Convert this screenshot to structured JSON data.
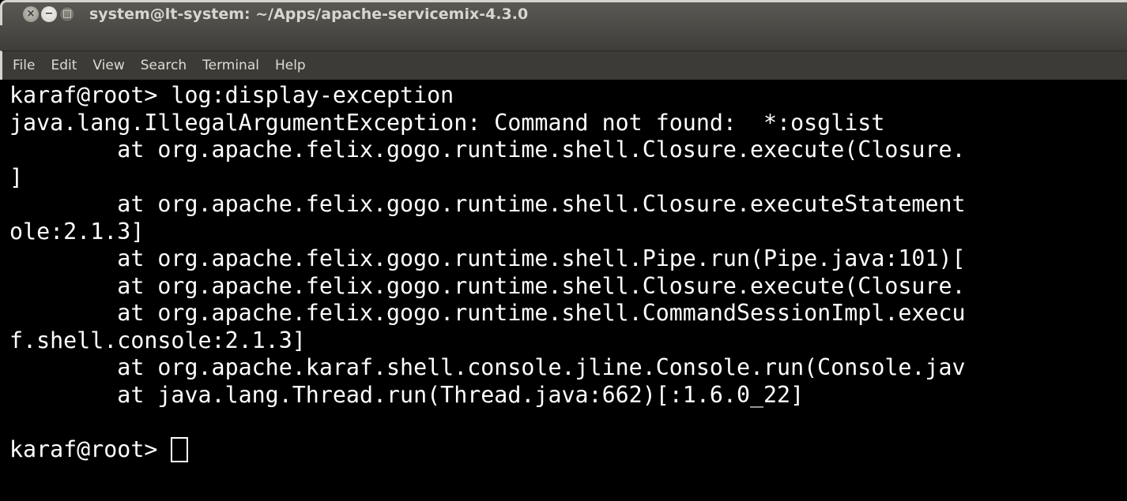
{
  "window": {
    "title": "system@lt-system: ~/Apps/apache-servicemix-4.3.0",
    "controls": {
      "close_glyph": "×",
      "minimize_glyph": "−",
      "maximize_glyph": "□"
    }
  },
  "menubar": {
    "items": [
      "File",
      "Edit",
      "View",
      "Search",
      "Terminal",
      "Help"
    ]
  },
  "terminal": {
    "lines": [
      "karaf@root> log:display-exception",
      "java.lang.IllegalArgumentException: Command not found:  *:osglist",
      "        at org.apache.felix.gogo.runtime.shell.Closure.execute(Closure.",
      "]",
      "        at org.apache.felix.gogo.runtime.shell.Closure.executeStatement",
      "ole:2.1.3]",
      "        at org.apache.felix.gogo.runtime.shell.Pipe.run(Pipe.java:101)[",
      "        at org.apache.felix.gogo.runtime.shell.Closure.execute(Closure.",
      "        at org.apache.felix.gogo.runtime.shell.CommandSessionImpl.execu",
      "f.shell.console:2.1.3]",
      "        at org.apache.karaf.shell.console.jline.Console.run(Console.jav",
      "        at java.lang.Thread.run(Thread.java:662)[:1.6.0_22]",
      ""
    ],
    "prompt": "karaf@root>"
  },
  "colors": {
    "terminal_bg": "#000000",
    "terminal_fg": "#ffffff",
    "titlebar_bg": "#4b4a46",
    "menubar_bg": "#3c3b37",
    "title_text": "#d9d6cf"
  }
}
